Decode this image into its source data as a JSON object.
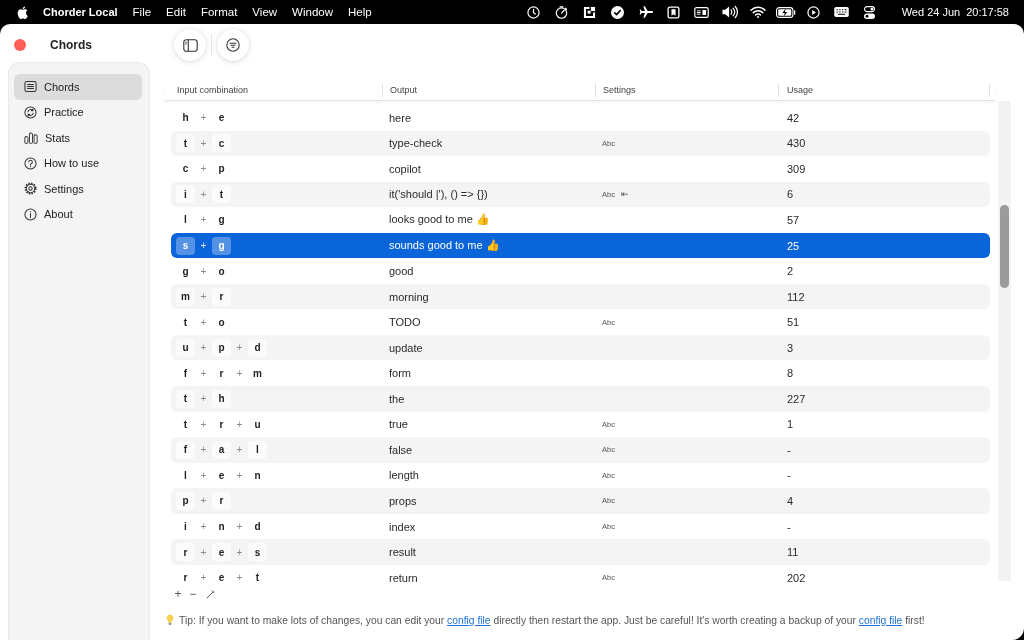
{
  "menu_bar": {
    "app_name": "Chorder Local",
    "menus": [
      "File",
      "Edit",
      "Format",
      "View",
      "Window",
      "Help"
    ],
    "date": "Wed 24 Jun",
    "time": "20:17:58"
  },
  "window": {
    "title": "Chords"
  },
  "sidebar": {
    "items": [
      {
        "label": "Chords",
        "selected": true
      },
      {
        "label": "Practice",
        "selected": false
      },
      {
        "label": "Stats",
        "selected": false
      },
      {
        "label": "How to use",
        "selected": false
      },
      {
        "label": "Settings",
        "selected": false
      },
      {
        "label": "About",
        "selected": false
      }
    ]
  },
  "table": {
    "columns": [
      "Input combination",
      "Output",
      "Settings",
      "Usage"
    ],
    "rows": [
      {
        "input": [
          "h",
          "+",
          "e"
        ],
        "output": "here",
        "usage": "42",
        "selected": false
      },
      {
        "input": [
          "t",
          "+",
          "c"
        ],
        "output": "type-check",
        "settings": [
          {
            "kind": "text",
            "label": "Abc"
          }
        ],
        "usage": "430",
        "selected": false
      },
      {
        "input": [
          "c",
          "+",
          "p"
        ],
        "output": "copilot",
        "usage": "309",
        "selected": false
      },
      {
        "input": [
          "i",
          "+",
          "t"
        ],
        "output": "it('should |'), () => {})",
        "settings": [
          {
            "kind": "text",
            "label": "Abc"
          },
          {
            "kind": "glyph",
            "label": "⇤"
          }
        ],
        "usage": "6",
        "selected": false
      },
      {
        "input": [
          "l",
          "+",
          "g"
        ],
        "output": "looks good to me 👍",
        "usage": "57",
        "selected": false
      },
      {
        "input": [
          "s",
          "+",
          "g"
        ],
        "output": "sounds good to me 👍",
        "usage": "25",
        "selected": true
      },
      {
        "input": [
          "g",
          "+",
          "o"
        ],
        "output": "good",
        "usage": "2",
        "selected": false
      },
      {
        "input": [
          "m",
          "+",
          "r"
        ],
        "output": "morning",
        "usage": "112",
        "selected": false
      },
      {
        "input": [
          "t",
          "+",
          "o"
        ],
        "output": "TODO",
        "settings": [
          {
            "kind": "text",
            "label": "Abc"
          }
        ],
        "usage": "51",
        "selected": false
      },
      {
        "input": [
          "u",
          "+",
          "p",
          "+",
          "d"
        ],
        "output": "update",
        "usage": "3",
        "selected": false
      },
      {
        "input": [
          "f",
          "+",
          "r",
          "+",
          "m"
        ],
        "output": "form",
        "usage": "8",
        "selected": false
      },
      {
        "input": [
          "t",
          "+",
          "h"
        ],
        "output": "the",
        "usage": "227",
        "selected": false
      },
      {
        "input": [
          "t",
          "+",
          "r",
          "+",
          "u"
        ],
        "output": "true",
        "settings": [
          {
            "kind": "text",
            "label": "Abc"
          }
        ],
        "usage": "1",
        "selected": false
      },
      {
        "input": [
          "f",
          "+",
          "a",
          "+",
          "l"
        ],
        "output": "false",
        "settings": [
          {
            "kind": "text",
            "label": "Abc"
          }
        ],
        "usage": "-",
        "selected": false
      },
      {
        "input": [
          "l",
          "+",
          "e",
          "+",
          "n"
        ],
        "output": "length",
        "settings": [
          {
            "kind": "text",
            "label": "Abc"
          }
        ],
        "usage": "-",
        "selected": false
      },
      {
        "input": [
          "p",
          "+",
          "r"
        ],
        "output": "props",
        "settings": [
          {
            "kind": "text",
            "label": "Abc"
          }
        ],
        "usage": "4",
        "selected": false
      },
      {
        "input": [
          "i",
          "+",
          "n",
          "+",
          "d"
        ],
        "output": "index",
        "settings": [
          {
            "kind": "text",
            "label": "Abc"
          }
        ],
        "usage": "-",
        "selected": false
      },
      {
        "input": [
          "r",
          "+",
          "e",
          "+",
          "s"
        ],
        "output": "result",
        "usage": "11",
        "selected": false
      },
      {
        "input": [
          "r",
          "+",
          "e",
          "+",
          "t"
        ],
        "output": "return",
        "settings": [
          {
            "kind": "text",
            "label": "Abc"
          }
        ],
        "usage": "202",
        "selected": false
      }
    ]
  },
  "table_actions": [
    {
      "kind": "add",
      "label": "+"
    },
    {
      "kind": "remove",
      "label": "−"
    },
    {
      "kind": "edit"
    }
  ],
  "tip": {
    "segments": [
      {
        "kind": "text",
        "text": "Tip: If you want to make lots of changes, you can edit your "
      },
      {
        "kind": "link",
        "text": "config file"
      },
      {
        "kind": "text",
        "text": " directly then restart the app. Just be careful! It's worth creating a backup of your "
      },
      {
        "kind": "link",
        "text": "config file"
      },
      {
        "kind": "text",
        "text": " first!"
      }
    ]
  }
}
